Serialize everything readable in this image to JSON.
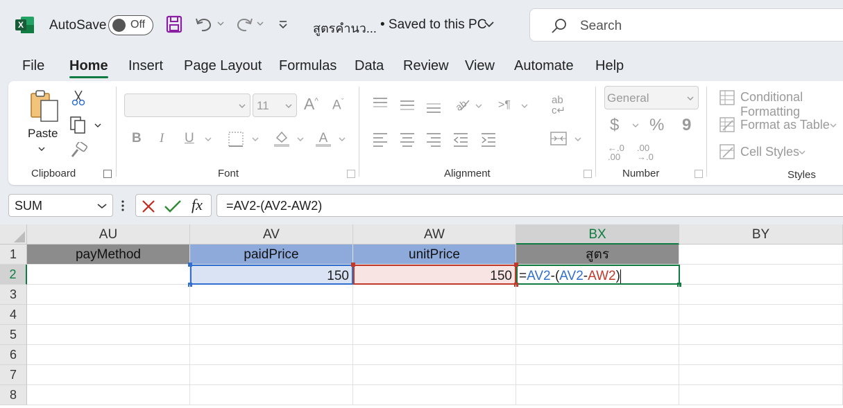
{
  "titlebar": {
    "autosave_label": "AutoSave",
    "autosave_state": "Off",
    "doc_title": "สูตรคำนว...",
    "saved_state": "• Saved to this PC",
    "search_placeholder": "Search"
  },
  "tabs": [
    "File",
    "Home",
    "Insert",
    "Page Layout",
    "Formulas",
    "Data",
    "Review",
    "View",
    "Automate",
    "Help"
  ],
  "active_tab": "Home",
  "ribbon": {
    "clipboard": {
      "paste_label": "Paste",
      "group_label": "Clipboard"
    },
    "font": {
      "font_size": "11",
      "group_label": "Font",
      "bold": "B",
      "italic": "I",
      "underline": "U"
    },
    "alignment": {
      "group_label": "Alignment"
    },
    "number": {
      "format": "General",
      "group_label": "Number",
      "currency": "$",
      "percent": "%",
      "comma": "9",
      "inc_decimal": "←.0\n.00",
      "dec_decimal": ".00\n→.0"
    },
    "styles": {
      "conditional_formatting": "Conditional Formatting",
      "format_as_table": "Format as Table",
      "cell_styles": "Cell Styles",
      "group_label": "Styles"
    }
  },
  "formula_bar": {
    "name_box": "SUM",
    "formula": "=AV2-(AV2-AW2)"
  },
  "sheet": {
    "columns": [
      "AU",
      "AV",
      "AW",
      "BX",
      "BY"
    ],
    "selected_column": "BX",
    "rows": [
      "1",
      "2",
      "3",
      "4",
      "5",
      "6",
      "7",
      "8"
    ],
    "selected_row": "2",
    "row1": {
      "AU": "payMethod",
      "AV": "paidPrice",
      "AW": "unitPrice",
      "BX": "สูตร"
    },
    "row2": {
      "AU": "",
      "AV": "150",
      "AW": "150"
    },
    "edit_formula": {
      "eq": "=",
      "ref1": "AV2",
      "minus1": "-(",
      "ref2": "AV2",
      "minus2": "-",
      "ref3": "AW2",
      "close": ")"
    }
  },
  "colors": {
    "accent": "#107c41",
    "header_gray": "#8c8c8c",
    "header_blue": "#8eaadb",
    "ref_blue": "#2f6fd0",
    "ref_red": "#c0392b"
  }
}
